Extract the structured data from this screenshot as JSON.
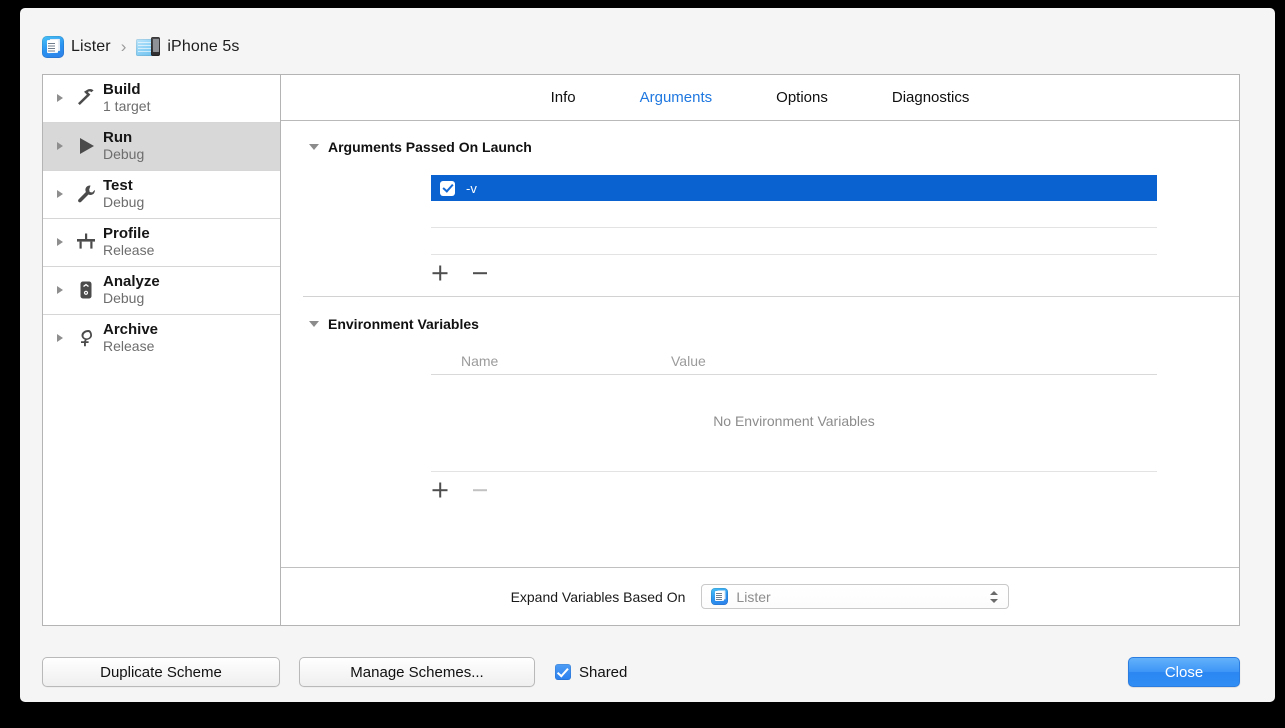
{
  "window": {
    "breadcrumb": {
      "scheme_icon": "lister-app-icon",
      "scheme_name": "Lister",
      "separator": "›",
      "destination_icon": "iphone-device-icon",
      "destination_name": "iPhone 5s"
    }
  },
  "sidebar": {
    "items": [
      {
        "title": "Build",
        "subtitle": "1 target",
        "icon": "hammer-icon",
        "selected": false
      },
      {
        "title": "Run",
        "subtitle": "Debug",
        "icon": "play-icon",
        "selected": true
      },
      {
        "title": "Test",
        "subtitle": "Debug",
        "icon": "wrench-icon",
        "selected": false
      },
      {
        "title": "Profile",
        "subtitle": "Release",
        "icon": "instrument-icon",
        "selected": false
      },
      {
        "title": "Analyze",
        "subtitle": "Debug",
        "icon": "analyze-icon",
        "selected": false
      },
      {
        "title": "Archive",
        "subtitle": "Release",
        "icon": "archive-icon",
        "selected": false
      }
    ]
  },
  "tabs": [
    {
      "label": "Info",
      "active": false
    },
    {
      "label": "Arguments",
      "active": true
    },
    {
      "label": "Options",
      "active": false
    },
    {
      "label": "Diagnostics",
      "active": false
    }
  ],
  "arguments_section": {
    "title": "Arguments Passed On Launch",
    "rows": [
      {
        "value": "-v",
        "checked": true,
        "selected": true
      }
    ],
    "add_button": "+",
    "remove_button": "−",
    "remove_enabled": true
  },
  "environment_section": {
    "title": "Environment Variables",
    "columns": [
      "Name",
      "Value"
    ],
    "empty_message": "No Environment Variables",
    "rows": [],
    "add_button": "+",
    "remove_button": "−",
    "remove_enabled": false
  },
  "expand_bar": {
    "label": "Expand Variables Based On",
    "popup_icon": "lister-app-icon",
    "popup_value": "Lister"
  },
  "bottom_bar": {
    "duplicate_label": "Duplicate Scheme",
    "manage_label": "Manage Schemes...",
    "shared_label": "Shared",
    "shared_checked": true,
    "close_label": "Close"
  },
  "colors": {
    "accent_blue": "#1f78e0",
    "selection_blue": "#0a62d0",
    "default_button_blue": "#3d95f6",
    "checkbox_blue": "#2a7fee",
    "window_bg": "#f5f5f5",
    "panel_bg": "#ffffff",
    "sidebar_selected": "#d8d8d8"
  }
}
